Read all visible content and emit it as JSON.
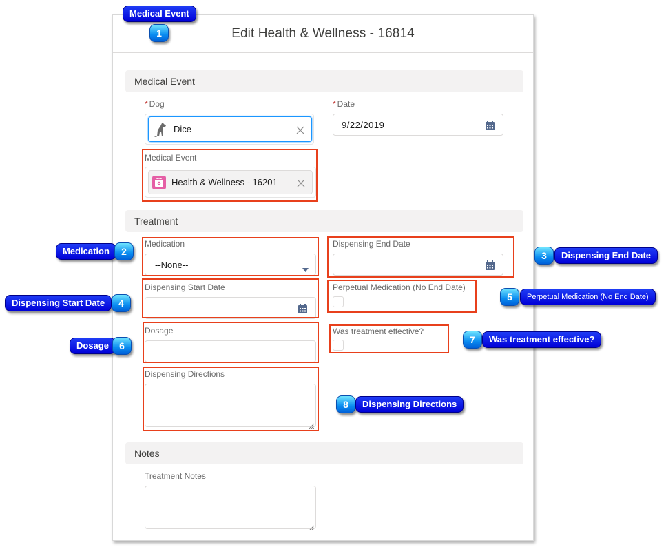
{
  "modal": {
    "title": "Edit Health & Wellness - 16814"
  },
  "sections": {
    "medical_event": "Medical Event",
    "treatment": "Treatment",
    "notes": "Notes"
  },
  "fields": {
    "dog": {
      "label": "Dog",
      "required_mark": "*",
      "value": "Dice",
      "icon": "dog-icon"
    },
    "date": {
      "label": "Date",
      "required_mark": "*",
      "value": "9/22/2019",
      "icon": "calendar-icon"
    },
    "medical_event": {
      "label": "Medical Event",
      "value": "Health & Wellness - 16201",
      "icon": "medical-kit-icon"
    },
    "medication": {
      "label": "Medication",
      "value": "--None--"
    },
    "dispensing_end_date": {
      "label": "Dispensing End Date",
      "value": ""
    },
    "dispensing_start_date": {
      "label": "Dispensing Start Date",
      "value": ""
    },
    "perpetual_medication": {
      "label": "Perpetual Medication (No End Date)",
      "checked": false
    },
    "dosage": {
      "label": "Dosage",
      "value": ""
    },
    "was_treatment_effective": {
      "label": "Was treatment effective?",
      "checked": false
    },
    "dispensing_directions": {
      "label": "Dispensing Directions",
      "value": ""
    },
    "treatment_notes": {
      "label": "Treatment Notes",
      "value": ""
    }
  },
  "callouts": [
    {
      "number": "1",
      "label": "Medical Event"
    },
    {
      "number": "2",
      "label": "Medication"
    },
    {
      "number": "3",
      "label": "Dispensing End Date"
    },
    {
      "number": "4",
      "label": "Dispensing Start Date"
    },
    {
      "number": "5",
      "label": "Perpetual Medication (No End Date)"
    },
    {
      "number": "6",
      "label": "Dosage"
    },
    {
      "number": "7",
      "label": "Was treatment effective?"
    },
    {
      "number": "8",
      "label": "Dispensing Directions"
    }
  ],
  "colors": {
    "annotation_box": "#e8401c",
    "callout_blue": "#0000d8",
    "focus_blue": "#1b96ff",
    "medical_icon_pink": "#e55fa5",
    "calendar_icon": "#54698d"
  }
}
